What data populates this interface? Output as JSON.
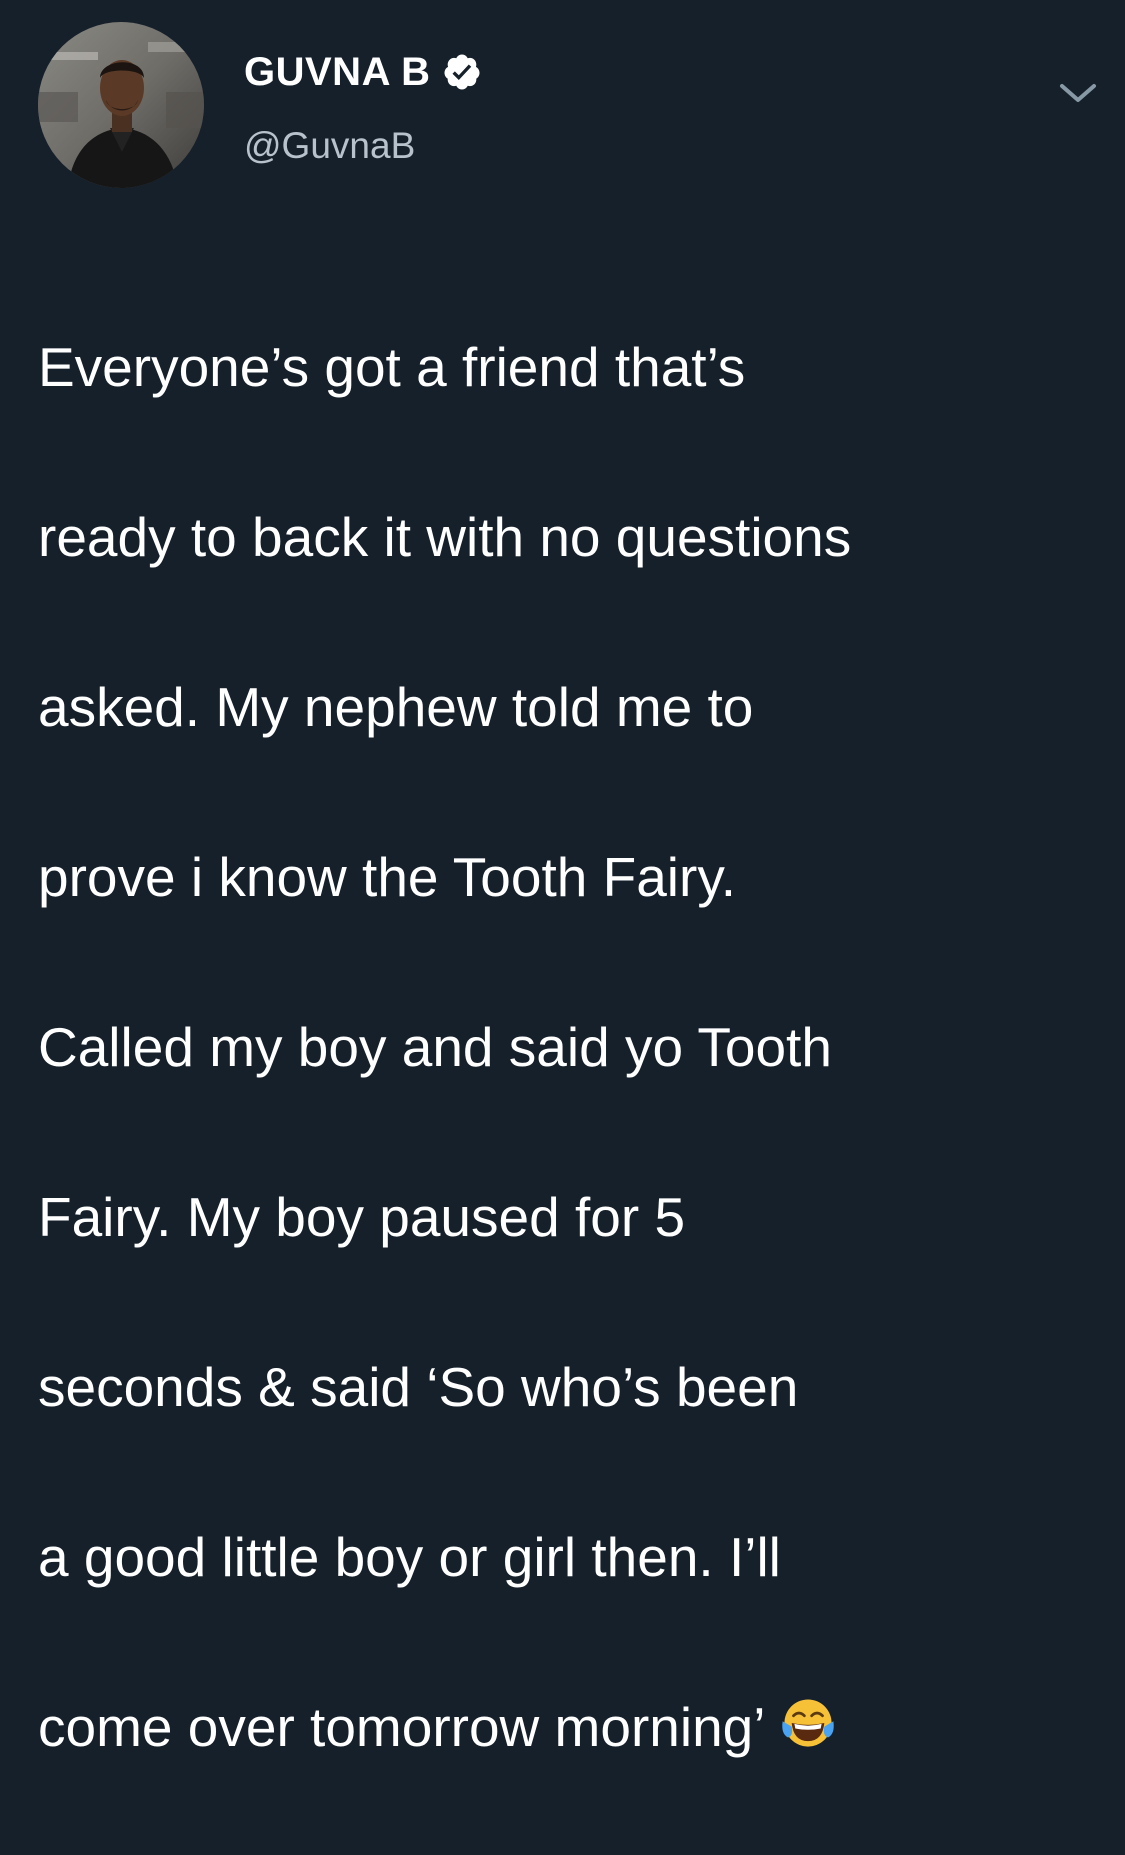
{
  "tweet": {
    "author": {
      "display_name": "GUVNA B",
      "handle": "@GuvnaB",
      "verified": true,
      "avatar_icon": "profile-photo"
    },
    "menu_icon": "chevron-down-icon",
    "text_lines": [
      "Everyone’s got a friend that’s",
      "ready to back it with no questions",
      "asked. My nephew told me to",
      "prove i know the Tooth Fairy.",
      "Called my boy and said yo Tooth",
      "Fairy. My boy paused for 5",
      "seconds & said ‘So who’s been",
      "a good little boy or girl then. I’ll",
      "come over tomorrow morning’"
    ],
    "trailing_emoji": "face-with-tears-of-joy"
  },
  "colors": {
    "background": "#15202b",
    "text": "#ffffff",
    "handle": "#b8c2cc"
  }
}
